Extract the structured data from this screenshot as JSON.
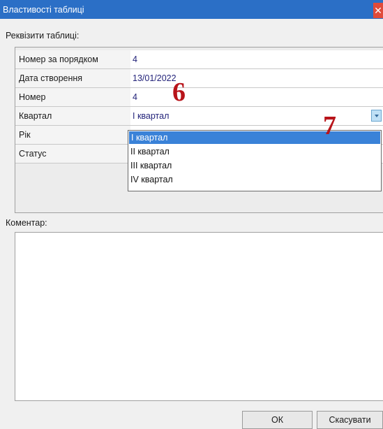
{
  "window": {
    "title": "Властивості таблиці",
    "close": "✕"
  },
  "details": {
    "label": "Реквізити таблиці:",
    "rows": [
      {
        "label": "Номер за порядком",
        "value": "4"
      },
      {
        "label": "Дата створення",
        "value": "13/01/2022"
      },
      {
        "label": "Номер",
        "value": "4"
      },
      {
        "label": "Квартал",
        "value": "І квартал"
      },
      {
        "label": "Рік",
        "value": ""
      },
      {
        "label": "Статус",
        "value": ""
      }
    ]
  },
  "quarter_dropdown": {
    "options": [
      "І квартал",
      "ІІ квартал",
      "ІІІ квартал",
      "ІV квартал"
    ],
    "selected_index": 0
  },
  "annotations": {
    "marker_6": "6",
    "marker_7": "7"
  },
  "comment": {
    "label": "Коментар:",
    "value": ""
  },
  "buttons": {
    "ok": "ОК",
    "cancel": "Скасувати"
  },
  "colors": {
    "titlebar": "#2b6fc6",
    "selection": "#3a82d8",
    "marker": "#b8141a",
    "value_text": "#23237a"
  }
}
